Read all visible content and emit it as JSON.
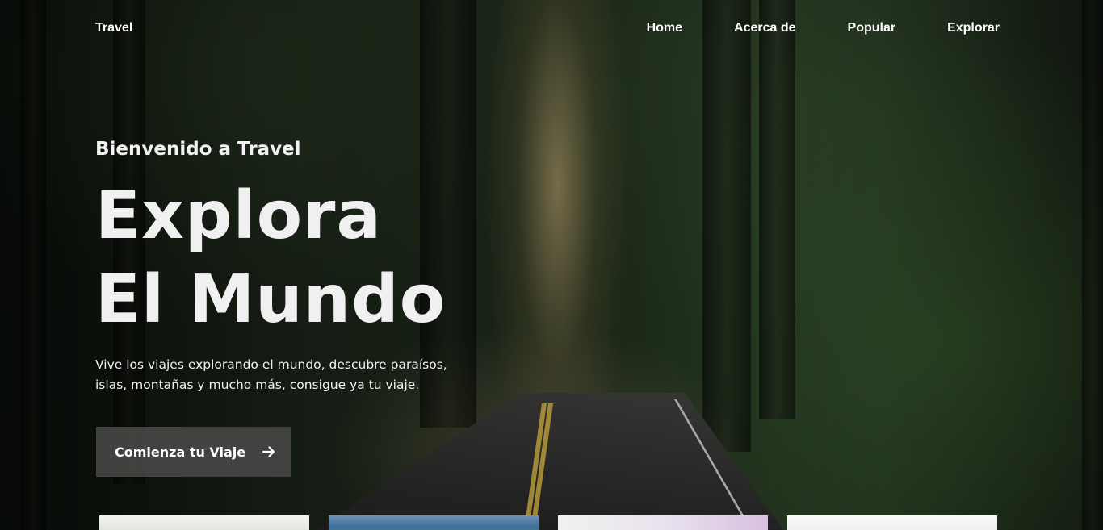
{
  "nav": {
    "logo": "Travel",
    "links": [
      "Home",
      "Acerca de",
      "Popular",
      "Explorar"
    ]
  },
  "hero": {
    "subtitle": "Bienvenido a Travel",
    "title_line1": "Explora",
    "title_line2": "El Mundo",
    "description": "Vive los viajes explorando el mundo, descubre paraísos, islas, montañas y mucho más, consigue ya tu viaje.",
    "cta_label": "Comienza tu Viaje",
    "cta_icon": "arrow-right-icon"
  },
  "colors": {
    "text": "#ffffff",
    "cta_bg": "#464644"
  }
}
